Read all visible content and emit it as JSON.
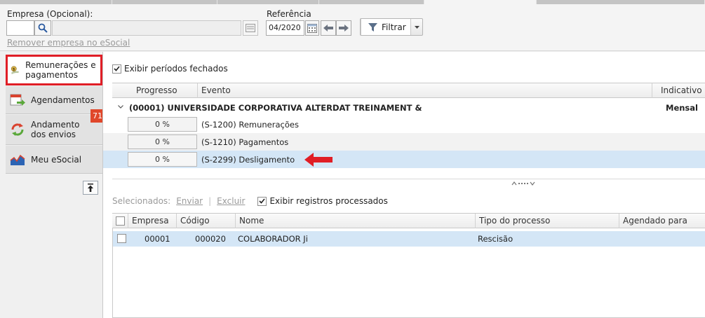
{
  "filters": {
    "empresa_label": "Empresa (Opcional):",
    "empresa_code": "",
    "empresa_name": "",
    "remove_link": "Remover empresa no eSocial",
    "referencia_label": "Referência",
    "referencia_value": "04/2020",
    "filtrar_label": "Filtrar"
  },
  "sidebar": {
    "items": [
      {
        "label": "Remunerações e pagamentos",
        "icon": "money-icon",
        "active": true
      },
      {
        "label": "Agendamentos",
        "icon": "calendar-arrow-icon",
        "active": false
      },
      {
        "label": "Andamento dos envios",
        "icon": "sync-icon",
        "active": false
      },
      {
        "label": "Meu eSocial",
        "icon": "chart-icon",
        "active": false
      }
    ],
    "badge": "71"
  },
  "events": {
    "show_closed_label": "Exibir períodos fechados",
    "show_closed_checked": true,
    "columns": [
      "Progresso",
      "Evento",
      "Indicativo"
    ],
    "group": {
      "title": "(00001) UNIVERSIDADE CORPORATIVA ALTERDAT TREINAMENT &",
      "indicativo": "Mensal"
    },
    "rows": [
      {
        "progress": "0 %",
        "event": "(S-1200) Remunerações",
        "selected": false
      },
      {
        "progress": "0 %",
        "event": "(S-1210) Pagamentos",
        "selected": false
      },
      {
        "progress": "0 %",
        "event": "(S-2299) Desligamento",
        "selected": true
      }
    ]
  },
  "records": {
    "toolbar": {
      "selected_label": "Selecionados:",
      "send": "Enviar",
      "sep": "|",
      "delete": "Excluir",
      "show_processed_label": "Exibir registros processados",
      "show_processed_checked": true
    },
    "columns": [
      "Empresa",
      "Código",
      "Nome",
      "Tipo do processo",
      "Agendado para"
    ],
    "rows": [
      {
        "empresa": "00001",
        "codigo": "000020",
        "nome": "COLABORADOR Ji",
        "tipo": "Rescisão",
        "agendado": ""
      }
    ]
  },
  "colors": {
    "accent_red": "#e01e26",
    "selected_row": "#d4e6f6",
    "badge": "#e0472a"
  }
}
